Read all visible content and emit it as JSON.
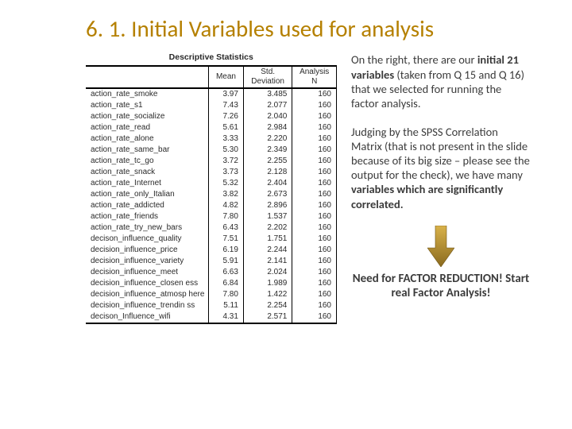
{
  "title": "6. 1. Initial Variables used for analysis",
  "table": {
    "caption": "Descriptive Statistics",
    "headers": {
      "name": "",
      "mean": "Mean",
      "sd": "Std. Deviation",
      "n": "Analysis N"
    },
    "rows": [
      {
        "name": "action_rate_smoke",
        "mean": "3.97",
        "sd": "3.485",
        "n": "160"
      },
      {
        "name": "action_rate_s1",
        "mean": "7.43",
        "sd": "2.077",
        "n": "160"
      },
      {
        "name": "action_rate_socialize",
        "mean": "7.26",
        "sd": "2.040",
        "n": "160"
      },
      {
        "name": "action_rate_read",
        "mean": "5.61",
        "sd": "2.984",
        "n": "160"
      },
      {
        "name": "action_rate_alone",
        "mean": "3.33",
        "sd": "2.220",
        "n": "160"
      },
      {
        "name": "action_rate_same_bar",
        "mean": "5.30",
        "sd": "2.349",
        "n": "160"
      },
      {
        "name": "action_rate_tc_go",
        "mean": "3.72",
        "sd": "2.255",
        "n": "160"
      },
      {
        "name": "action_rate_snack",
        "mean": "3.73",
        "sd": "2.128",
        "n": "160"
      },
      {
        "name": "action_rate_Internet",
        "mean": "5.32",
        "sd": "2.404",
        "n": "160"
      },
      {
        "name": "action_rate_only_Italian",
        "mean": "3.82",
        "sd": "2.673",
        "n": "160"
      },
      {
        "name": "action_rate_addicted",
        "mean": "4.82",
        "sd": "2.896",
        "n": "160"
      },
      {
        "name": "action_rate_friends",
        "mean": "7.80",
        "sd": "1.537",
        "n": "160"
      },
      {
        "name": "action_rate_try_new_bars",
        "mean": "6.43",
        "sd": "2.202",
        "n": "160"
      },
      {
        "name": "decison_influence_quality",
        "mean": "7.51",
        "sd": "1.751",
        "n": "160"
      },
      {
        "name": "decision_influence_price",
        "mean": "6.19",
        "sd": "2.244",
        "n": "160"
      },
      {
        "name": "decision_influence_variety",
        "mean": "5.91",
        "sd": "2.141",
        "n": "160"
      },
      {
        "name": "decision_influence_meet",
        "mean": "6.63",
        "sd": "2.024",
        "n": "160"
      },
      {
        "name": "decision_influence_closen ess",
        "mean": "6.84",
        "sd": "1.989",
        "n": "160"
      },
      {
        "name": "decision_influence_atmosp here",
        "mean": "7.80",
        "sd": "1.422",
        "n": "160"
      },
      {
        "name": "decision_influence_trendin ss",
        "mean": "5.11",
        "sd": "2.254",
        "n": "160"
      },
      {
        "name": "decison_Influence_wifi",
        "mean": "4.31",
        "sd": "2.571",
        "n": "160"
      }
    ]
  },
  "paragraphs": {
    "p1_a": "On the right, there are our ",
    "p1_b": "initial 21 variables",
    "p1_c": " (taken from Q 15  and Q 16) that we selected for running the factor analysis.",
    "p2_a": "Judging by the SPSS Correlation Matrix  (that is not present in the slide because of its big size – please see the output for the check), we have many ",
    "p2_b": "variables which are significantly correlated."
  },
  "conclusion": "Need for FACTOR REDUCTION! Start real Factor Analysis!"
}
